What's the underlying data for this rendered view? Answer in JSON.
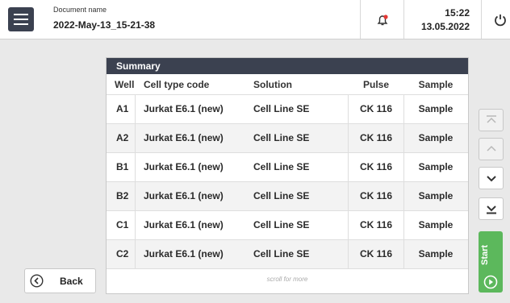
{
  "header": {
    "doc_label": "Document name",
    "doc_value": "2022-May-13_15-21-38",
    "time": "15:22",
    "date": "13.05.2022",
    "alert_color": "#e53935"
  },
  "summary": {
    "title": "Summary",
    "columns": [
      "Well",
      "Cell type code",
      "Solution",
      "Pulse",
      "Sample"
    ],
    "rows": [
      [
        "A1",
        "Jurkat E6.1 (new)",
        "Cell Line SE",
        "CK 116",
        "Sample"
      ],
      [
        "A2",
        "Jurkat E6.1 (new)",
        "Cell Line SE",
        "CK 116",
        "Sample"
      ],
      [
        "B1",
        "Jurkat E6.1 (new)",
        "Cell Line SE",
        "CK 116",
        "Sample"
      ],
      [
        "B2",
        "Jurkat E6.1 (new)",
        "Cell Line SE",
        "CK 116",
        "Sample"
      ],
      [
        "C1",
        "Jurkat E6.1 (new)",
        "Cell Line SE",
        "CK 116",
        "Sample"
      ],
      [
        "C2",
        "Jurkat E6.1 (new)",
        "Cell Line SE",
        "CK 116",
        "Sample"
      ]
    ],
    "scroll_hint": "scroll for more"
  },
  "controls": {
    "start_label": "Start",
    "back_label": "Back",
    "start_color": "#5cb85c"
  },
  "icons": [
    "menu-icon",
    "bell-icon",
    "power-icon",
    "scroll-top-icon",
    "scroll-up-icon",
    "scroll-down-icon",
    "scroll-bottom-icon",
    "play-icon",
    "back-arrow-icon"
  ]
}
